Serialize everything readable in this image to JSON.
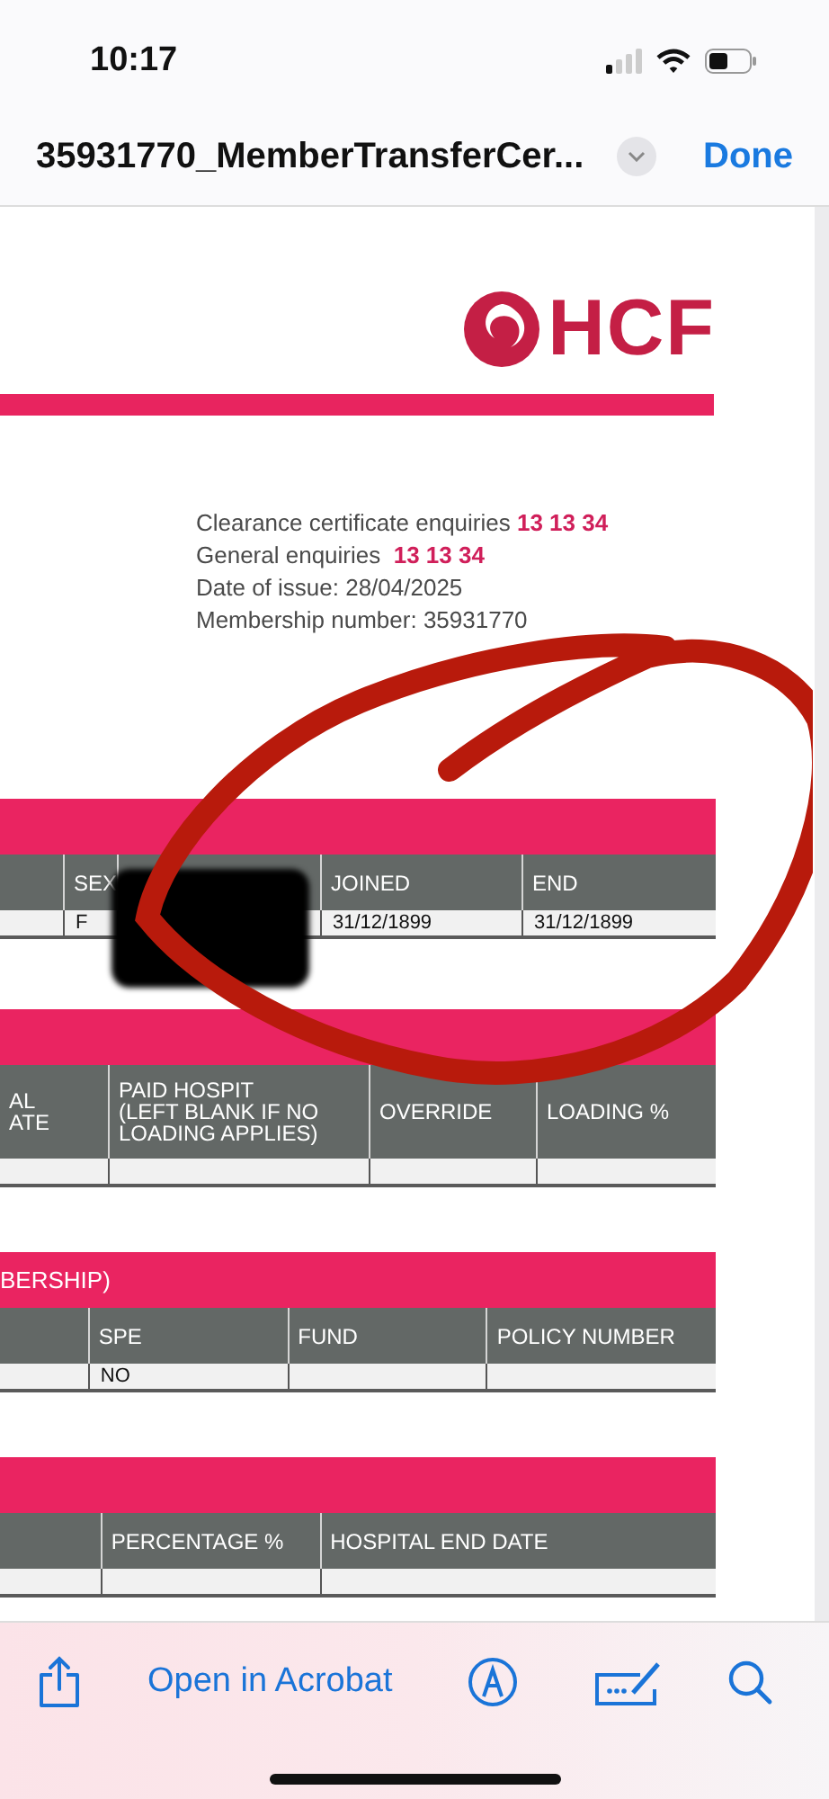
{
  "status_bar": {
    "time": "10:17"
  },
  "nav": {
    "title": "35931770_MemberTransferCer...",
    "done": "Done"
  },
  "document": {
    "logo": {
      "text": "HCF"
    },
    "info_lines": [
      "Clearance certificate enquiries **13 13 34**",
      "General enquiries  **13 13 34**",
      "Date of issue: 28/04/2025",
      "Membership number: 35931770"
    ],
    "sections": [
      {
        "columns": [
          {
            "kind": "blank"
          },
          {
            "kind": "label",
            "lines": [
              "SEX"
            ]
          },
          {
            "kind": "redacted"
          },
          {
            "kind": "label",
            "lines": [
              "JOINED"
            ]
          },
          {
            "kind": "label",
            "lines": [
              "END"
            ]
          }
        ],
        "row": [
          {
            "kind": "empty"
          },
          {
            "kind": "text",
            "text": "F"
          },
          {
            "kind": "empty"
          },
          {
            "kind": "text",
            "text": "31/12/1899"
          },
          {
            "kind": "text",
            "text": "31/12/1899"
          }
        ]
      },
      {
        "columns": [
          {
            "kind": "label",
            "lines": [
              "AL",
              "ATE"
            ]
          },
          {
            "kind": "label",
            "lines": [
              "PAID HOSPIT",
              "(LEFT BLANK IF NO",
              "LOADING APPLIES)"
            ]
          },
          {
            "kind": "label",
            "lines": [
              "OVERRIDE"
            ]
          },
          {
            "kind": "label",
            "lines": [
              "LOADING %"
            ]
          }
        ],
        "row": [
          {
            "kind": "empty"
          },
          {
            "kind": "empty"
          },
          {
            "kind": "empty"
          },
          {
            "kind": "empty"
          }
        ]
      },
      {
        "band": "BERSHIP)",
        "columns": [
          {
            "kind": "blank"
          },
          {
            "kind": "label",
            "lines": [
              "SPE"
            ]
          },
          {
            "kind": "label",
            "lines": [
              "FUND"
            ]
          },
          {
            "kind": "label",
            "lines": [
              "POLICY NUMBER"
            ]
          }
        ],
        "row": [
          {
            "kind": "empty"
          },
          {
            "kind": "text",
            "text": "NO"
          },
          {
            "kind": "empty"
          },
          {
            "kind": "empty"
          }
        ]
      },
      {
        "columns": [
          {
            "kind": "blank"
          },
          {
            "kind": "label",
            "lines": [
              "PERCENTAGE %"
            ]
          },
          {
            "kind": "label",
            "lines": [
              "HOSPITAL END DATE"
            ]
          }
        ],
        "row": [
          {
            "kind": "empty"
          },
          {
            "kind": "empty"
          },
          {
            "kind": "empty"
          }
        ]
      }
    ]
  },
  "toolbar": {
    "open_label": "Open in Acrobat"
  }
}
